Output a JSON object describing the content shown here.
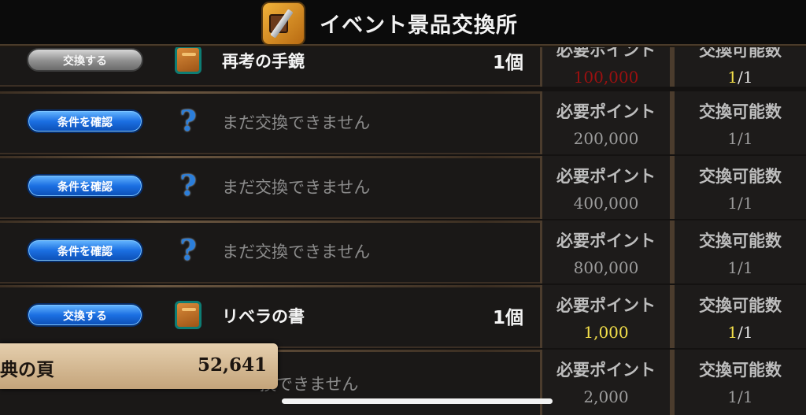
{
  "header": {
    "title": "イベント景品交換所",
    "icon": "event-exchange-icon"
  },
  "column_labels": {
    "points": "必要ポイント",
    "count": "交換可能数"
  },
  "rows": [
    {
      "button": "交換する",
      "button_style": "gray",
      "icon": "book-icon",
      "name": "再考の手鏡",
      "qty": "1個",
      "points_head": "必要ポイント",
      "points": "100,000",
      "points_color": "red",
      "count_head": "交換可能数",
      "count_num": "1",
      "count_total": "/1"
    },
    {
      "button": "条件を確認",
      "button_style": "blue",
      "icon": "question-icon",
      "name": "まだ交換できません",
      "qty": "",
      "points_head": "必要ポイント",
      "points": "200,000",
      "count_head": "交換可能数",
      "count_num": "1",
      "count_total": "/1"
    },
    {
      "button": "条件を確認",
      "button_style": "blue",
      "icon": "question-icon",
      "name": "まだ交換できません",
      "qty": "",
      "points_head": "必要ポイント",
      "points": "400,000",
      "count_head": "交換可能数",
      "count_num": "1",
      "count_total": "/1"
    },
    {
      "button": "条件を確認",
      "button_style": "blue",
      "icon": "question-icon",
      "name": "まだ交換できません",
      "qty": "",
      "points_head": "必要ポイント",
      "points": "800,000",
      "count_head": "交換可能数",
      "count_num": "1",
      "count_total": "/1"
    },
    {
      "button": "交換する",
      "button_style": "blue",
      "icon": "book-icon",
      "name": "リベラの書",
      "qty": "1個",
      "points_head": "必要ポイント",
      "points": "1,000",
      "points_color": "yellow",
      "count_head": "交換可能数",
      "count_num": "1",
      "count_total": "/1"
    },
    {
      "button": "",
      "button_style": "none",
      "icon": "",
      "name": "換できません",
      "qty": "",
      "points_head": "必要ポイント",
      "points": "2,000",
      "count_head": "交換可能数",
      "count_num": "1",
      "count_total": "/1"
    }
  ],
  "points_panel": {
    "label": "典の頁",
    "value": "52,641"
  },
  "colors": {
    "accent_blue": "#1b6fe2",
    "yellow": "#f4e04a",
    "red": "#9b1010"
  }
}
